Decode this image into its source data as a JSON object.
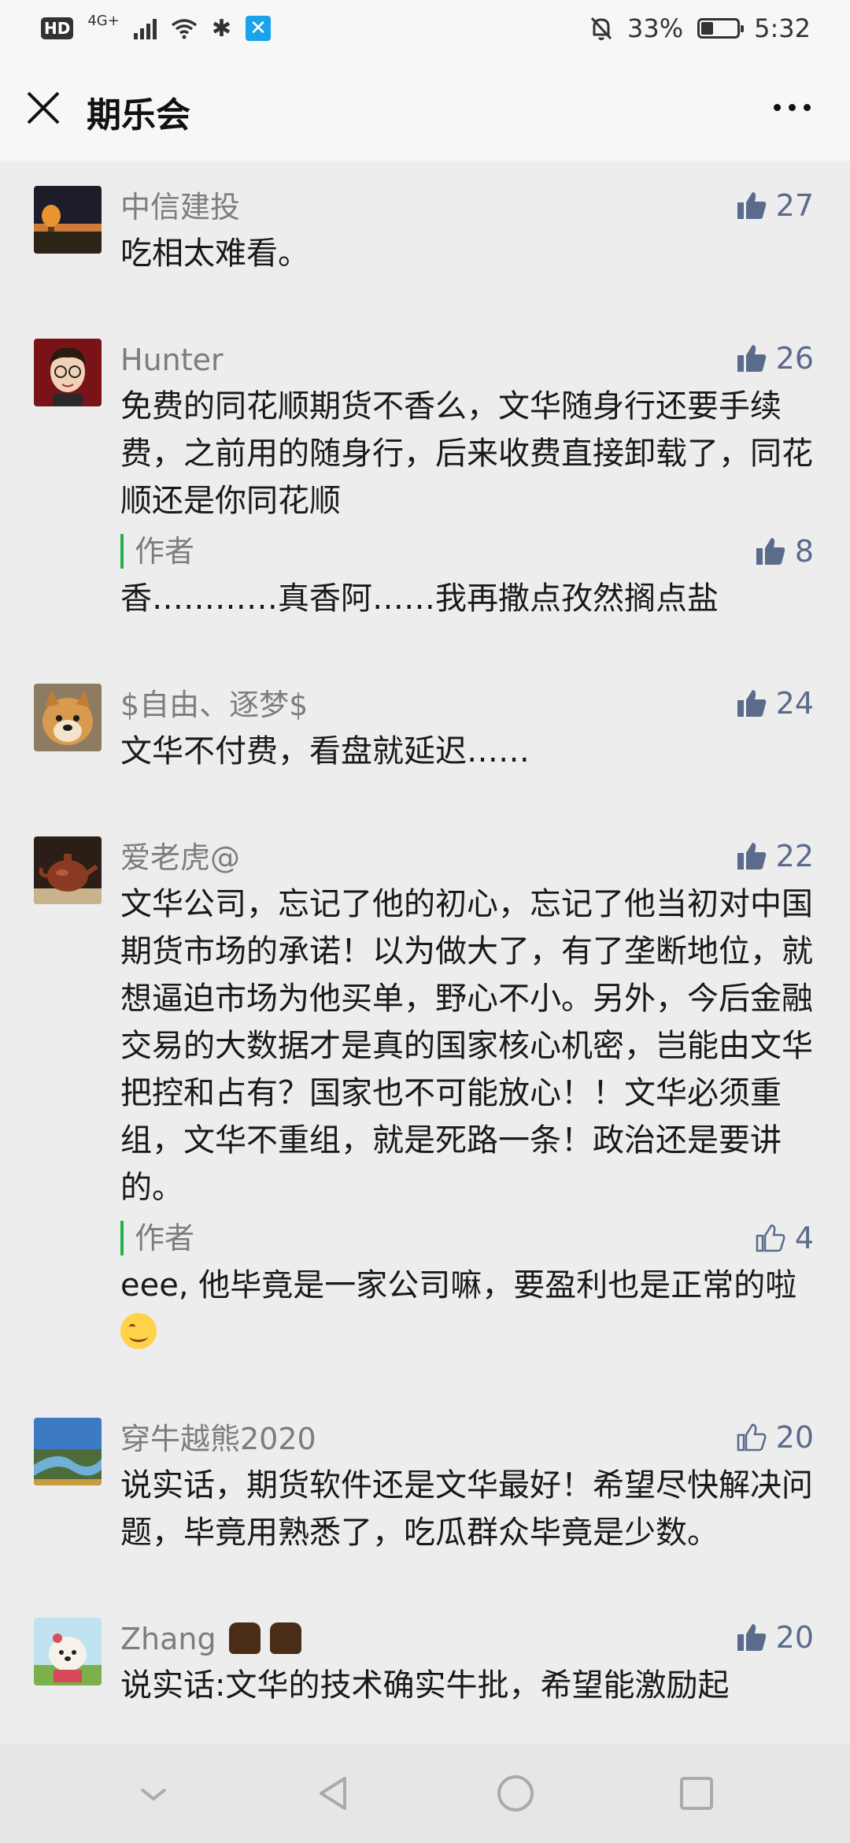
{
  "status_bar": {
    "hd": "HD",
    "network": "4G+",
    "battery_percent": "33%",
    "battery_level": 0.33,
    "time": "5:32",
    "icons": [
      "signal-icon",
      "wifi-icon",
      "bluetooth-icon",
      "app-x-icon",
      "mute-bell-icon",
      "battery-icon"
    ]
  },
  "title_bar": {
    "title": "期乐会"
  },
  "colors": {
    "author_bar": "#22b24c",
    "like": "#5b6b8b",
    "name": "#7d7d7d"
  },
  "comments": [
    {
      "name": "中信建投",
      "likes": "27",
      "liked": true,
      "text": "吃相太难看。"
    },
    {
      "name": "Hunter",
      "likes": "26",
      "liked": true,
      "text": "免费的同花顺期货不香么，文华随身行还要手续费，之前用的随身行，后来收费直接卸载了，同花顺还是你同花顺",
      "reply": {
        "name": "作者",
        "likes": "8",
        "liked": true,
        "text": "香…………真香阿……我再撒点孜然搁点盐"
      }
    },
    {
      "name": "$自由、逐梦$",
      "likes": "24",
      "liked": true,
      "text": "文华不付费，看盘就延迟……"
    },
    {
      "name": "爱老虎@",
      "likes": "22",
      "liked": true,
      "text": "文华公司，忘记了他的初心，忘记了他当初对中国期货市场的承诺！以为做大了，有了垄断地位，就想逼迫市场为他买单，野心不小。另外，今后金融交易的大数据才是真的国家核心机密，岂能由文华把控和占有？国家也不可能放心！！文华必须重组，文华不重组，就是死路一条！政治还是要讲的。",
      "reply": {
        "name": "作者",
        "likes": "4",
        "liked": false,
        "text": "eee, 他毕竟是一家公司嘛，要盈利也是正常的啦"
      }
    },
    {
      "name": "穿牛越熊2020",
      "likes": "20",
      "liked": false,
      "text": "说实话，期货软件还是文华最好！希望尽快解决问题，毕竟用熟悉了，吃瓜群众毕竟是少数。"
    },
    {
      "name": "Zhang",
      "likes": "20",
      "liked": true,
      "text": "说实话:文华的技术确实牛批，希望能激励起"
    }
  ]
}
